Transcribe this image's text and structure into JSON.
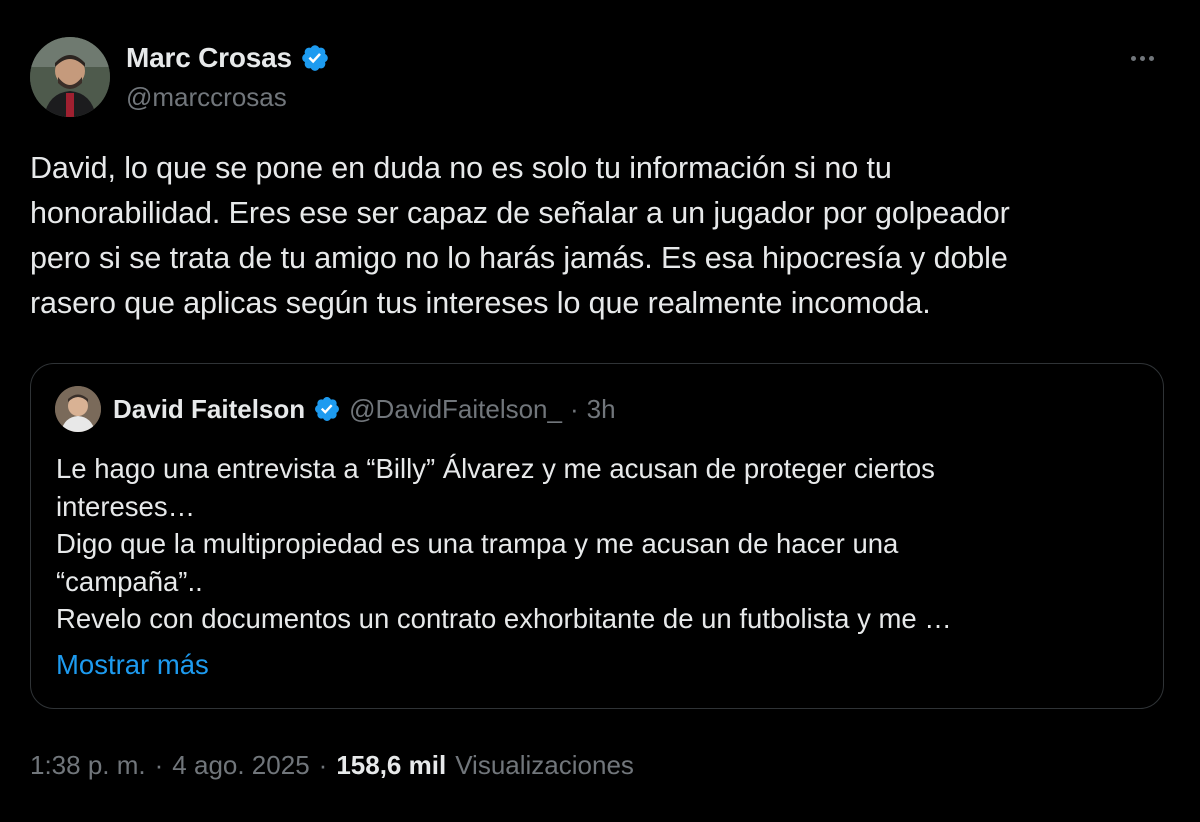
{
  "author": {
    "name": "Marc Crosas",
    "handle": "@marccrosas",
    "verified_color": "#1d9bf0"
  },
  "menu": {
    "icon": "more-horizontal-icon"
  },
  "tweet": {
    "text_lines": [
      "David, lo que se pone en duda no es solo tu información si no tu",
      "honorabilidad. Eres ese ser capaz de señalar a un jugador por golpeador",
      "pero si se trata de tu amigo no lo harás jamás. Es esa hipocresía y doble",
      "rasero que aplicas según tus intereses lo que realmente incomoda."
    ]
  },
  "quote": {
    "name": "David Faitelson",
    "handle": "@DavidFaitelson_",
    "separator": "·",
    "time": "3h",
    "text_lines": [
      "Le hago una entrevista a “Billy” Álvarez y me acusan de proteger ciertos",
      "intereses…",
      "Digo que la multipropiedad es una trampa y me acusan de hacer una",
      "“campaña”..",
      "Revelo con documentos un contrato exhorbitante de un futbolista y me …"
    ],
    "show_more": "Mostrar más"
  },
  "meta": {
    "time": "1:38 p. m.",
    "sep1": "·",
    "date": "4 ago. 2025",
    "sep2": "·",
    "views_count": "158,6 mil",
    "views_label": "Visualizaciones"
  },
  "colors": {
    "background": "#000000",
    "text": "#e7e9ea",
    "secondary": "#71767b",
    "accent": "#1d9bf0",
    "border": "#2f3336"
  }
}
